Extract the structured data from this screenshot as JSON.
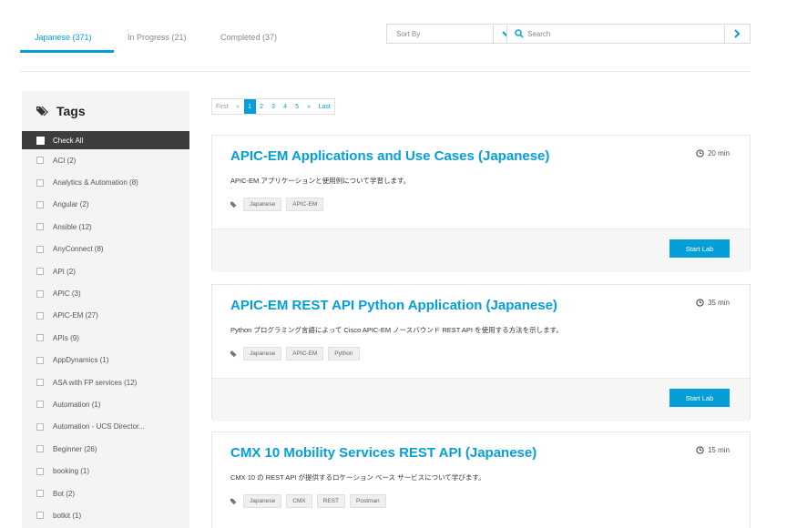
{
  "tabs": [
    {
      "label": "Japanese (371)"
    },
    {
      "label": "In Progress (21)"
    },
    {
      "label": "Completed (37)"
    }
  ],
  "sort": {
    "label": "Sort By"
  },
  "search": {
    "placeholder": "Search"
  },
  "sidebar": {
    "title": "Tags",
    "check_all": "Check All",
    "tags": [
      {
        "label": "ACI (2)"
      },
      {
        "label": "Analytics & Automation (8)"
      },
      {
        "label": "Angular (2)"
      },
      {
        "label": "Ansible (12)"
      },
      {
        "label": "AnyConnect (8)"
      },
      {
        "label": "API (2)"
      },
      {
        "label": "APIC (3)"
      },
      {
        "label": "APIC-EM (27)"
      },
      {
        "label": "APIs (9)"
      },
      {
        "label": "AppDynamics (1)"
      },
      {
        "label": "ASA with FP services (12)"
      },
      {
        "label": "Automation (1)"
      },
      {
        "label": "Automation - UCS Director..."
      },
      {
        "label": "Beginner (26)"
      },
      {
        "label": "booking (1)"
      },
      {
        "label": "Bot (2)"
      },
      {
        "label": "botkit (1)"
      }
    ]
  },
  "pagination": {
    "first": "First",
    "prev": "«",
    "pages": [
      "1",
      "2",
      "3",
      "4",
      "5"
    ],
    "next": "»",
    "last": "Last",
    "current": "1"
  },
  "labs": [
    {
      "title": "APIC-EM Applications and Use Cases (Japanese)",
      "time": "20 min",
      "description": "APIC-EM アプリケーションと使用例について学習します。",
      "tags": [
        "Japanese",
        "APIC-EM"
      ],
      "button": "Start Lab"
    },
    {
      "title": "APIC-EM REST API Python Application (Japanese)",
      "time": "35 min",
      "description": "Python プログラミング言語によって Cisco APIC-EM ノースバウンド REST API を使用する方法を示します。",
      "tags": [
        "Japanese",
        "APIC-EM",
        "Python"
      ],
      "button": "Start Lab"
    },
    {
      "title": "CMX 10 Mobility Services REST API (Japanese)",
      "time": "15 min",
      "description": "CMX 10 の REST API が提供するロケーション ベース サービスについて学びます。",
      "tags": [
        "Japanese",
        "CMX",
        "REST",
        "Postman"
      ],
      "button": "Start Lab"
    }
  ],
  "colors": {
    "accent": "#049fd9",
    "dark": "#3d3d3d"
  }
}
